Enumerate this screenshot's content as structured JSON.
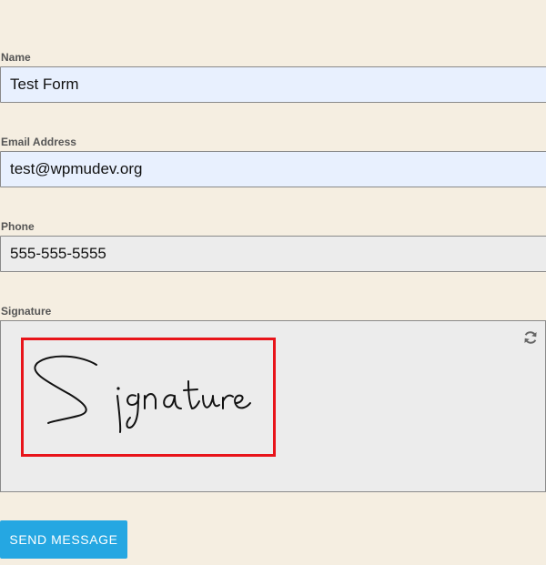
{
  "form": {
    "name": {
      "label": "Name",
      "value": "Test Form"
    },
    "email": {
      "label": "Email Address",
      "value": "test@wpmudev.org"
    },
    "phone": {
      "label": "Phone",
      "value": "555-555-5555"
    },
    "signature": {
      "label": "Signature",
      "refresh_icon": "refresh-icon"
    },
    "submit_label": "SEND MESSAGE"
  },
  "colors": {
    "page_background": "#f5eee1",
    "autofill_field": "#e8f0fe",
    "field_background": "#ececec",
    "highlight_border": "#e8141a",
    "button": "#25a7e2"
  }
}
